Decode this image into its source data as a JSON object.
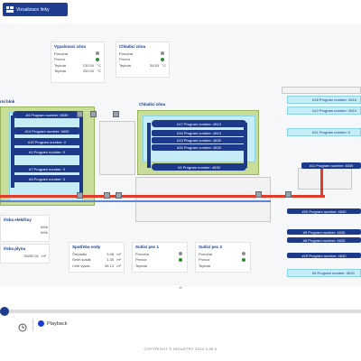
{
  "app": {
    "title": "Vizualizace linky"
  },
  "zones": {
    "vypalovaci_label": "Vypalovací zóna",
    "chladici_label": "Chladicí zóna",
    "left_label": "rní blok",
    "chladici_zona_map_label": "Chladicí zóna"
  },
  "panels": {
    "vypalovaci": {
      "title": "Vypalovací zóna",
      "rows": [
        {
          "label": "Porucha",
          "value": "",
          "unit": "",
          "dot": "#8d8d8d"
        },
        {
          "label": "Provoz",
          "value": "",
          "unit": "",
          "dot": "#2e8b2e"
        },
        {
          "label": "Teplota",
          "value": "130.00",
          "unit": "°C"
        },
        {
          "label": "Teplota",
          "value": "200.00",
          "unit": "°C"
        }
      ]
    },
    "chladici": {
      "title": "Chladicí zóna",
      "rows": [
        {
          "label": "Porucha",
          "value": "",
          "unit": "",
          "dot": "#8d8d8d"
        },
        {
          "label": "Provoz",
          "value": "",
          "unit": "",
          "dot": "#2e8b2e"
        },
        {
          "label": "Teplota",
          "value": "35.53",
          "unit": "°C"
        }
      ]
    },
    "spotreba_elektriny": {
      "title": "třeba elektřiny",
      "rows": [
        {
          "label": "",
          "value": "",
          "unit": "kWh"
        },
        {
          "label": "",
          "value": "",
          "unit": "kWh"
        }
      ]
    },
    "spotreba_plynu": {
      "title": "třeba plynu",
      "rows": [
        {
          "label": "",
          "value": "39250.31",
          "unit": "m³"
        }
      ]
    },
    "spotreba_vody": {
      "title": "Spotřeba vody",
      "rows": [
        {
          "label": "Čerpadlo",
          "value": "3.08",
          "unit": "m³"
        },
        {
          "label": "Semi sušák",
          "value": "1.35",
          "unit": "m³"
        },
        {
          "label": "Celé vysav.",
          "value": "35.13",
          "unit": "m³"
        }
      ]
    },
    "susici_pec_1": {
      "title": "Sušící pec 1",
      "rows": [
        {
          "label": "Porucha",
          "dot": "#8d8d8d"
        },
        {
          "label": "Provoz",
          "dot": "#2e8b2e"
        },
        {
          "label": "Teplota",
          "value": "",
          "unit": ""
        }
      ]
    },
    "susici_pec_2": {
      "title": "Sušící pec 2",
      "rows": [
        {
          "label": "Porucha",
          "dot": "#8d8d8d"
        },
        {
          "label": "Provoz",
          "dot": "#2e8b2e"
        },
        {
          "label": "Teplota",
          "value": "",
          "unit": ""
        }
      ]
    }
  },
  "tracks": {
    "left": [
      "#4 Program number: 4630",
      "#14 Program number: 4630",
      "#15 Program number: 0",
      "#1 Program number: 0",
      "#7 Program number: 0",
      "#3 Program number: 0"
    ],
    "middle": [
      "#17 Program number: 4810",
      "#16 Program number: 4810",
      "#13 Program number: 4630",
      "#26 Program number: 4630",
      "#2 Program number: 4630"
    ],
    "right": [
      "#18 Program number: 4510",
      "#10 Program number: 4510",
      "#21 Program number: 0",
      "#11 Program number: 4630",
      "#20 Program number: 4630",
      "#9 Program number: 4630",
      "#8 Program number: 4630",
      "#19 Program number: 4630",
      "#5 Program number: 4630"
    ]
  },
  "playback": {
    "label": "Playback",
    "progress": 0.01
  },
  "footer": {
    "text": "COPYRIGHT © INDUSTRY 2024 2.89.0"
  }
}
